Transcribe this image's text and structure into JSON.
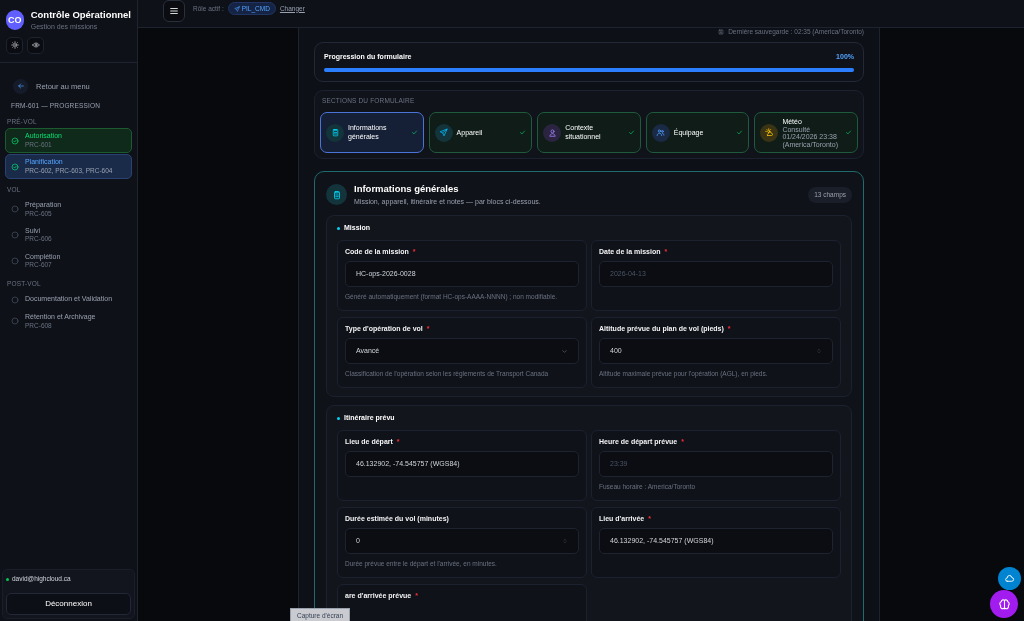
{
  "app": {
    "logo": "CO",
    "title": "Contrôle Opérationnel",
    "subtitle": "Gestion des missions"
  },
  "back": "Retour au menu",
  "nav_heading": "FRM-601 — PROGRESSION",
  "nav_groups": [
    {
      "title": "PRÉ-VOL",
      "items": [
        {
          "label": "Autorisation",
          "code": "PRC-601",
          "completed": true,
          "selected": false
        },
        {
          "label": "Planification",
          "code": "PRC-602, PRC-603, PRC-604",
          "completed": true,
          "selected": true
        }
      ]
    },
    {
      "title": "VOL",
      "items": [
        {
          "label": "Préparation",
          "code": "PRC-605",
          "completed": false,
          "selected": false
        },
        {
          "label": "Suivi",
          "code": "PRC-606",
          "completed": false,
          "selected": false
        },
        {
          "label": "Complétion",
          "code": "PRC-607",
          "completed": false,
          "selected": false
        }
      ]
    },
    {
      "title": "POST-VOL",
      "items": [
        {
          "label": "Documentation et Validation",
          "completed": false,
          "selected": false
        },
        {
          "label": "Rétention et Archivage",
          "code": "PRC-608",
          "completed": false,
          "selected": false
        }
      ]
    }
  ],
  "user": {
    "email": "david@highcloud.ca",
    "online": true
  },
  "logout": "Déconnexion",
  "topbar": {
    "role_label": "Rôle actif :",
    "role": "PIL_CMD",
    "change": "Changer"
  },
  "saved": "Dernière sauvegarde : 02:35 (America/Toronto)",
  "progress": {
    "title": "Progression du formulaire",
    "reading": "100%",
    "level": 1
  },
  "sections_heading": "SECTIONS DU FORMULAIRE",
  "sections": [
    {
      "kind": "clipboard",
      "label": "Informations générales",
      "complete": true,
      "selected": true
    },
    {
      "kind": "plane",
      "label": "Appareil",
      "complete": true,
      "selected": false
    },
    {
      "kind": "person",
      "label": "Contexte situationnel",
      "complete": true,
      "selected": false
    },
    {
      "kind": "users",
      "label": "Équipage",
      "complete": true,
      "selected": false
    },
    {
      "kind": "weather",
      "label": "Météo",
      "note": "Consulté 01/24/2026 23:38 (America/Toronto)",
      "complete": true,
      "selected": false
    }
  ],
  "panel": {
    "title": "Informations générales",
    "subtitle": "Mission, appareil, itinéraire et notes — par blocs ci-dessous.",
    "badge": "13 champs"
  },
  "blocks": [
    {
      "title": "Mission",
      "fields": [
        {
          "kind": "text",
          "label": "Code de la mission",
          "required_mark": "*",
          "value": "HC-ops-2026-0028",
          "help": "Généré automatiquement (format HC-ops-AAAA-NNNN) ; non modifiable."
        },
        {
          "kind": "text",
          "label": "Date de la mission",
          "required_mark": "*",
          "placeholder": "2026-04-13"
        },
        {
          "kind": "select",
          "label": "Type d'opération de vol",
          "required_mark": "*",
          "value": "Avancé",
          "help": "Classification de l'opération selon les règlements de Transport Canada"
        },
        {
          "kind": "number",
          "label": "Altitude prévue du plan de vol (pieds)",
          "required_mark": "*",
          "value": "400",
          "help": "Altitude maximale prévue pour l'opération (AGL), en pieds."
        }
      ]
    },
    {
      "title": "Itinéraire prévu",
      "fields": [
        {
          "kind": "text",
          "label": "Lieu de départ",
          "required_mark": "*",
          "value": "46.132902, -74.545757 (WGS84)"
        },
        {
          "kind": "text",
          "label": "Heure de départ prévue",
          "required_mark": "*",
          "placeholder": "23:39",
          "help": "Fuseau horaire : America/Toronto"
        },
        {
          "kind": "number",
          "label": "Durée estimée du vol (minutes)",
          "value": "0",
          "help": "Durée prévue entre le départ et l'arrivée, en minutes."
        },
        {
          "kind": "text",
          "label": "Lieu d'arrivée",
          "required_mark": "*",
          "value": "46.132902, -74.545757 (WGS84)"
        },
        {
          "kind": "partial",
          "label": "are d'arrivée prévue",
          "required_mark": "*"
        }
      ]
    }
  ],
  "tooltip": "Capture d'écran"
}
